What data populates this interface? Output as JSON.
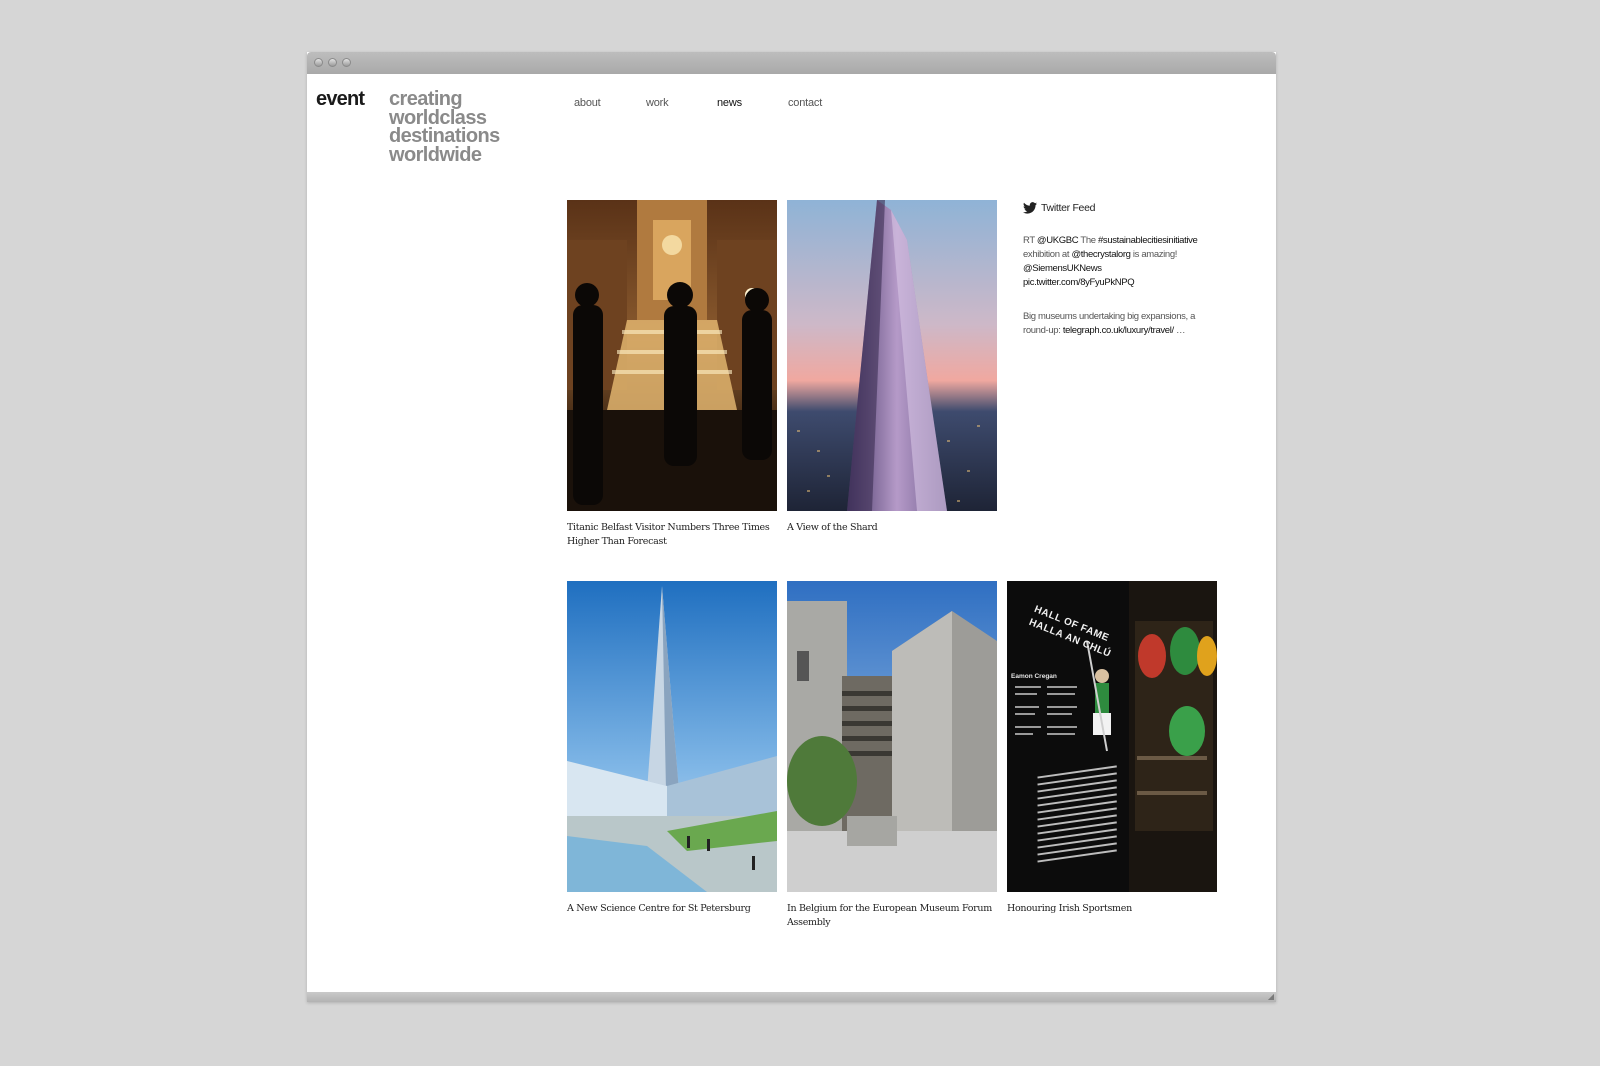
{
  "site": {
    "logo": "event",
    "tagline": [
      "creating",
      "worldclass",
      "destinations",
      "worldwide"
    ]
  },
  "nav": {
    "items": [
      {
        "label": "about",
        "active": false
      },
      {
        "label": "work",
        "active": false
      },
      {
        "label": "news",
        "active": true
      },
      {
        "label": "contact",
        "active": false
      }
    ]
  },
  "news": {
    "items": [
      {
        "caption": "Titanic Belfast Visitor Numbers Three Times Higher Than Forecast",
        "image": "titanic-staircase-photo"
      },
      {
        "caption": "A View of the Shard",
        "image": "shard-tower-photo"
      },
      {
        "caption": "A New Science Centre for St Petersburg",
        "image": "st-petersburg-tower-photo"
      },
      {
        "caption": "In Belgium for the European Museum Forum Assembly",
        "image": "stone-museum-building-photo"
      },
      {
        "caption": "Honouring Irish Sportsmen",
        "image": "hall-of-fame-exhibit-photo"
      }
    ]
  },
  "twitter": {
    "title": "Twitter Feed",
    "icon": "twitter-bird-icon",
    "tweets": [
      {
        "t1": "RT ",
        "l1": "@UKGBC",
        "t2": " The ",
        "l2": "#sustainablecitiesinitiative",
        "t3": " exhibition at ",
        "l3": "@thecrystalorg",
        "t4": " is amazing! ",
        "l4": "@SiemensUKNews",
        "t5": " ",
        "l5": "pic.twitter.com/8yFyuPkNPQ"
      },
      {
        "t1": "Big museums undertaking big expansions, a round-up: ",
        "l1": "telegraph.co.uk/luxury/travel/",
        "t2": " …"
      }
    ]
  },
  "hall_of_fame": {
    "heading1": "HALL OF FAME",
    "heading2": "HALLA AN CHLÚ",
    "name": "Eamon Cregan"
  },
  "colors": {
    "page_bg": "#d6d6d6",
    "window_bg": "#ffffff",
    "logo_text": "#1a1a1a",
    "tagline_text": "#8a8a8a"
  }
}
